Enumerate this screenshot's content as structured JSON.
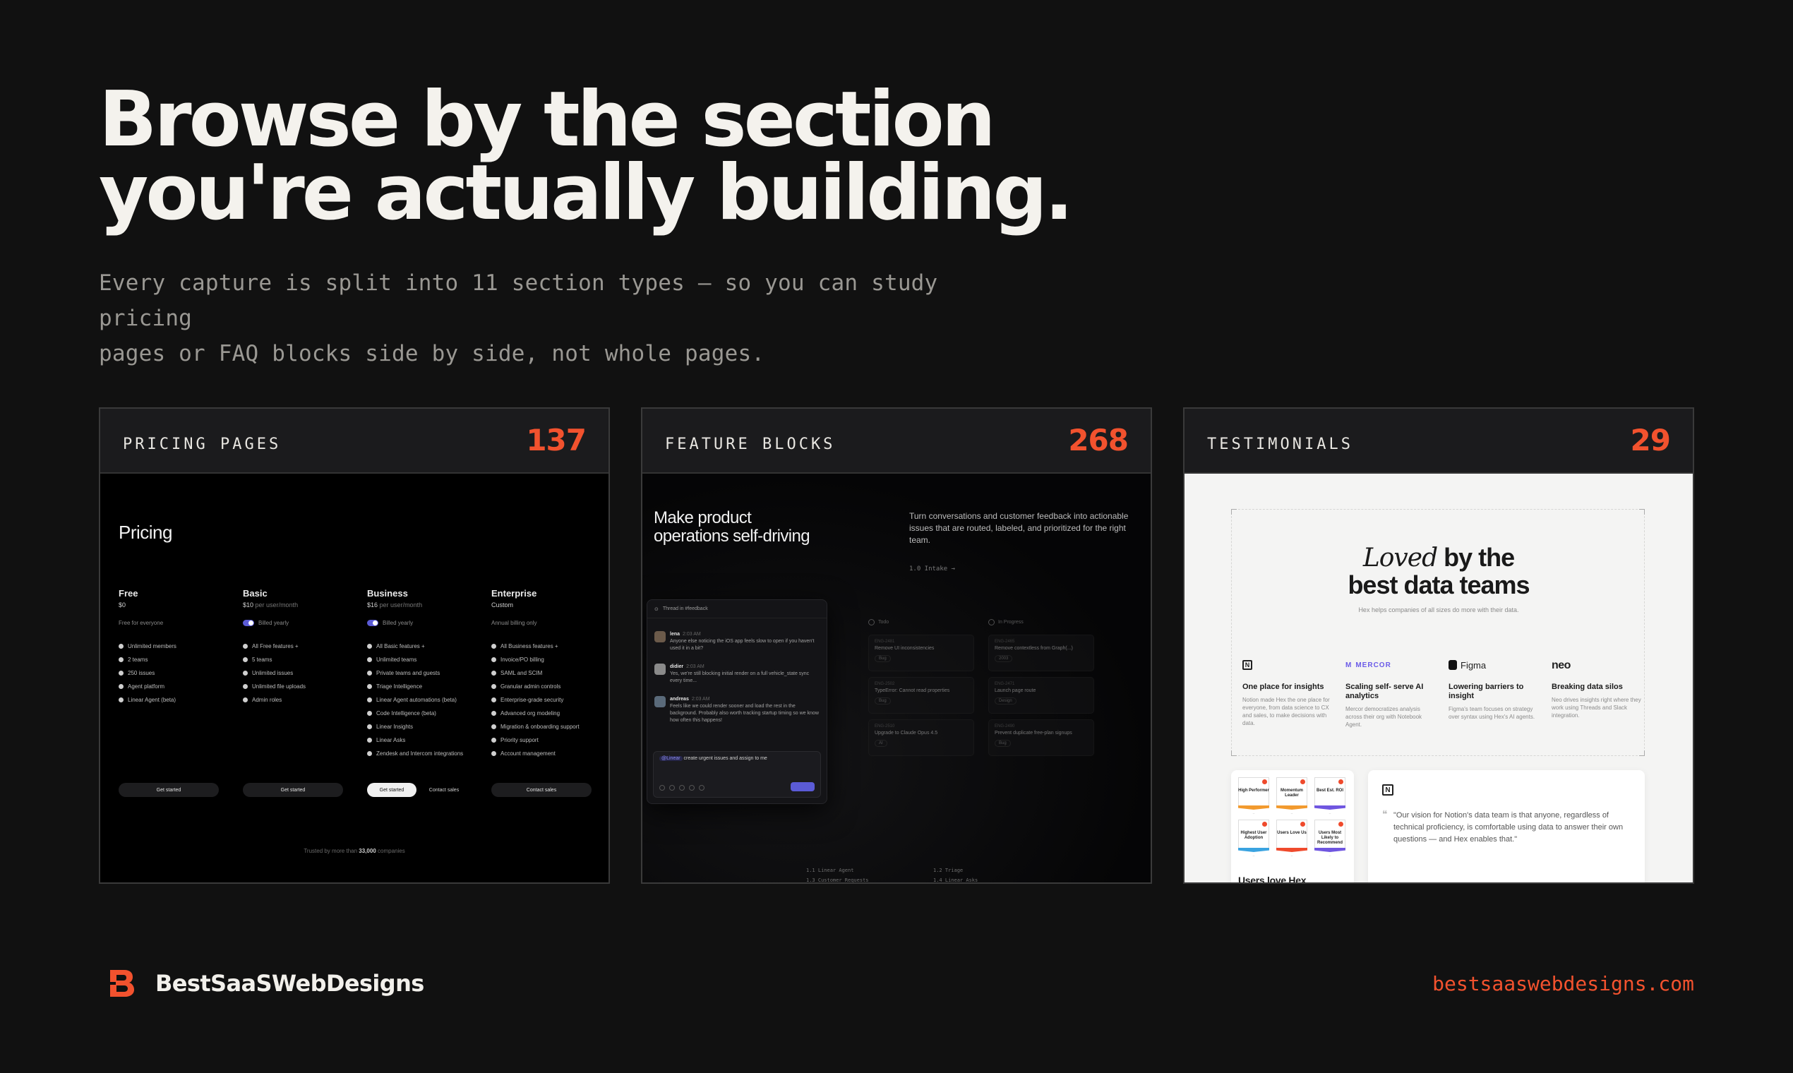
{
  "hero": {
    "title_line1": "Browse by the section",
    "title_line2": "you're actually building.",
    "subtitle_line1": "Every capture is split into 11 section types — so you can study pricing",
    "subtitle_line2": "pages or FAQ blocks side by side, not whole pages."
  },
  "colors": {
    "accent": "#f2522e",
    "background": "#111111",
    "text": "#f2f0eb"
  },
  "cards": [
    {
      "title": "PRICING PAGES",
      "count": "137",
      "preview": {
        "heading": "Pricing",
        "plans": [
          {
            "name": "Free",
            "price": "$0",
            "per": "",
            "note": "Free for everyone",
            "toggle": false,
            "features": [
              "Unlimited members",
              "2 teams",
              "250 issues",
              "Agent platform",
              "Linear Agent (beta)"
            ],
            "cta": "Get started"
          },
          {
            "name": "Basic",
            "price": "$10",
            "per": "per user/month",
            "note": "Billed yearly",
            "toggle": true,
            "features": [
              "All Free features +",
              "5 teams",
              "Unlimited issues",
              "Unlimited file uploads",
              "Admin roles"
            ],
            "cta": "Get started"
          },
          {
            "name": "Business",
            "price": "$16",
            "per": "per user/month",
            "note": "Billed yearly",
            "toggle": true,
            "features": [
              "All Basic features +",
              "Unlimited teams",
              "Private teams and guests",
              "Triage Intelligence",
              "Linear Agent automations (beta)",
              "Code Intelligence (beta)",
              "Linear Insights",
              "Linear Asks",
              "Zendesk and Intercom integrations"
            ],
            "cta": "Get started",
            "cta2": "Contact sales"
          },
          {
            "name": "Enterprise",
            "price": "Custom",
            "per": "",
            "note": "Annual billing only",
            "toggle": false,
            "features": [
              "All Business features +",
              "Invoice/PO billing",
              "SAML and SCIM",
              "Granular admin controls",
              "Enterprise-grade security",
              "Advanced org modeling",
              "Migration & onboarding support",
              "Priority support",
              "Account management"
            ],
            "cta": "Contact sales"
          }
        ],
        "footer_prefix": "Trusted by more than",
        "footer_count": "33,000",
        "footer_suffix": "companies"
      }
    },
    {
      "title": "FEATURE BLOCKS",
      "count": "268",
      "preview": {
        "heading_line1": "Make product",
        "heading_line2": "operations self-driving",
        "description": "Turn conversations and customer feedback into actionable issues that are routed, labeled, and prioritized for the right team.",
        "link": "1.0  Intake →",
        "thread_title": "Thread in #feedback",
        "messages": [
          {
            "who": "lena",
            "time": "2:03 AM",
            "text": "Anyone else noticing the iOS app feels slow to open if you haven't used it in a bit?"
          },
          {
            "who": "didier",
            "time": "2:03 AM",
            "text": "Yes, we're still blocking initial render on a full vehicle_state sync every time..."
          },
          {
            "who": "andreas",
            "time": "2:03 AM",
            "text": "Feels like we could render sooner and load the rest in the background. Probably also worth tracking startup timing so we know how often this happens!"
          }
        ],
        "compose_mention": "@Linear",
        "compose_text": "create urgent issues and assign to me",
        "columns": [
          "Todo",
          "In Progress"
        ],
        "tickets": [
          {
            "id": "ENG-2481",
            "title": "Remove UI inconsistencies",
            "tag": "Bug"
          },
          {
            "id": "ENG-2502",
            "title": "TypeError: Cannot read properties",
            "tag": "Bug"
          },
          {
            "id": "ENG-2510",
            "title": "Upgrade to Claude Opus 4.5",
            "tag": "AI"
          },
          {
            "id": "ENG-2465",
            "title": "Remove contextless from Graph(...)",
            "tag": "2003"
          },
          {
            "id": "ENG-2471",
            "title": "Launch page route",
            "tag": "Design"
          },
          {
            "id": "ENG-2490",
            "title": "Prevent duplicate free-plan signups",
            "tag": "Bug"
          }
        ],
        "bottom_links_left": [
          "1.1  Linear Agent",
          "1.3  Customer Requests"
        ],
        "bottom_links_right": [
          "1.2  Triage",
          "1.4  Linear Asks"
        ]
      }
    },
    {
      "title": "TESTIMONIALS",
      "count": "29",
      "preview": {
        "heading_italic": "Loved",
        "heading_rest": "by the",
        "heading_line2": "best data teams",
        "subheading": "Hex helps companies of all sizes do more with their data.",
        "columns": [
          {
            "logo": "N",
            "logo_name": "",
            "headline": "One place for insights",
            "text": "Notion made Hex the one place for everyone, from data science to CX and sales, to make decisions with data."
          },
          {
            "logo": "M",
            "logo_name": "MERCOR",
            "headline": "Scaling self- serve AI analytics",
            "text": "Mercor democratizes analysis across their org with Notebook Agent."
          },
          {
            "logo": "F",
            "logo_name": "Figma",
            "headline": "Lowering barriers to insight",
            "text": "Figma's team focuses on strategy over syntax using Hex's AI agents."
          },
          {
            "logo": "",
            "logo_name": "neo",
            "headline": "Breaking data silos",
            "text": "Neo drives insights right where they work using Threads and Slack integration."
          }
        ],
        "badges": [
          "High Performer",
          "Momentum Leader",
          "Best Est. ROI",
          "Highest User Adoption",
          "Users Love Us",
          "Users Most Likely to Recommend"
        ],
        "badges_caption": "Users love Hex",
        "quote": "\"Our vision for Notion's data team is that anyone, regardless of technical proficiency, is comfortable using data to answer their own questions — and Hex enables that.\"",
        "quote_logo": "N"
      }
    }
  ],
  "footer": {
    "brand_name": "BestSaaSWebDesigns",
    "brand_icon": "b-logo-icon",
    "site": "bestsaaswebdesigns.com"
  }
}
